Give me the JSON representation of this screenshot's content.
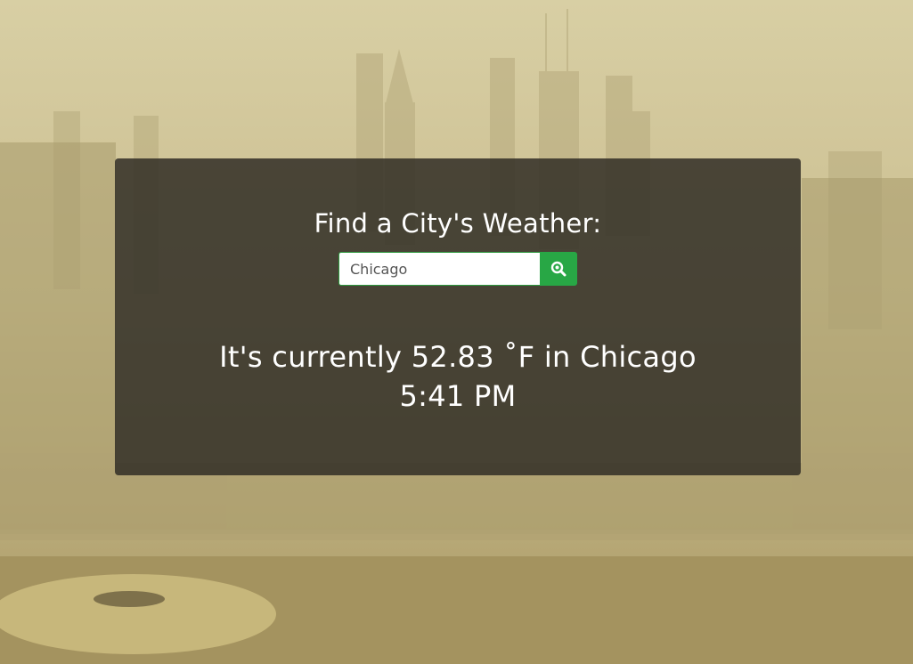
{
  "colors": {
    "panel_bg": "#322f26",
    "accent_green": "#28a745",
    "text": "#ffffff"
  },
  "finder": {
    "heading": "Find a City's Weather:",
    "search_value": "Chicago",
    "search_icon": "search-magnifier-icon"
  },
  "weather": {
    "prefix": "It's currently",
    "temperature": "52.83",
    "unit": "˚F",
    "city_prefix": "in",
    "city": "Chicago",
    "time": "5:41 PM"
  }
}
